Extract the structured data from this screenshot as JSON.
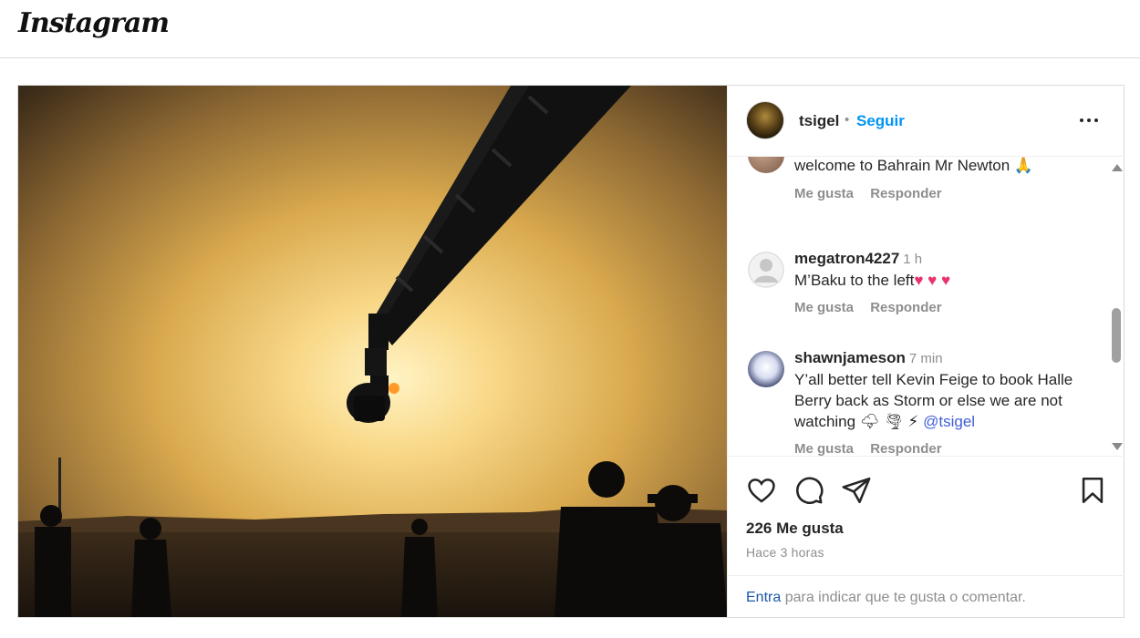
{
  "header": {
    "logo_text": "Instagram"
  },
  "post": {
    "owner": "tsigel",
    "separator": "•",
    "follow_label": "Seguir",
    "more_label": "Más opciones"
  },
  "comments": [
    {
      "user": "",
      "time": "",
      "text": "welcome to Bahrain Mr Newton 🙏",
      "like_label": "Me gusta",
      "reply_label": "Responder"
    },
    {
      "user": "megatron4227",
      "time": "1 h",
      "text": "M’Baku to the left",
      "hearts": "♥ ♥ ♥",
      "like_label": "Me gusta",
      "reply_label": "Responder"
    },
    {
      "user": "shawnjameson",
      "time": "7 min",
      "text": "Y’all better tell Kevin Feige to book Halle Berry back as Storm or else we are not watching 🌩 🌪 ⚡",
      "mention": "@tsigel",
      "like_label": "Me gusta",
      "reply_label": "Responder"
    }
  ],
  "stats": {
    "likes": "226 Me gusta",
    "time_ago": "Hace 3 horas"
  },
  "login": {
    "link": "Entra",
    "rest": " para indicar que te gusta o comentar."
  },
  "icons": {
    "like": "heart-icon",
    "comment": "comment-icon",
    "share": "paper-plane-icon",
    "save": "bookmark-icon",
    "more": "ellipsis-icon"
  },
  "colors": {
    "accent": "#0095f6",
    "text": "#262626",
    "muted": "#8e8e8e",
    "mention": "#3f5fd6",
    "heart": "#e8336b"
  }
}
